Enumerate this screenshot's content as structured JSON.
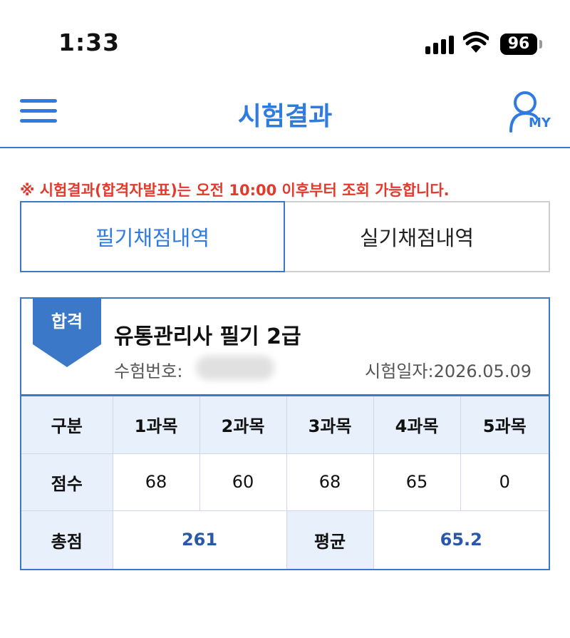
{
  "status": {
    "time": "1:33",
    "battery": "96"
  },
  "header": {
    "title": "시험결과",
    "my_label": "MY"
  },
  "notice": "※ 시험결과(합격자발표)는 오전 10:00 이후부터 조회 가능합니다.",
  "tabs": [
    {
      "label": "필기채점내역",
      "active": true
    },
    {
      "label": "실기채점내역",
      "active": false
    }
  ],
  "result": {
    "badge": "합격",
    "exam_name": "유통관리사 필기 2급",
    "exam_no_label": "수험번호:",
    "exam_date": "시험일자:2026.05.09",
    "table": {
      "header": [
        "구분",
        "1과목",
        "2과목",
        "3과목",
        "4과목",
        "5과목"
      ],
      "score_row_label": "점수",
      "scores": [
        "68",
        "60",
        "68",
        "65",
        "0"
      ],
      "total_label": "총점",
      "total": "261",
      "avg_label": "평균",
      "avg": "65.2"
    }
  },
  "colors": {
    "accent": "#2f7be0",
    "border": "#3b78c8",
    "notice": "#e23b2e",
    "header_cell": "#e8f0fb"
  }
}
